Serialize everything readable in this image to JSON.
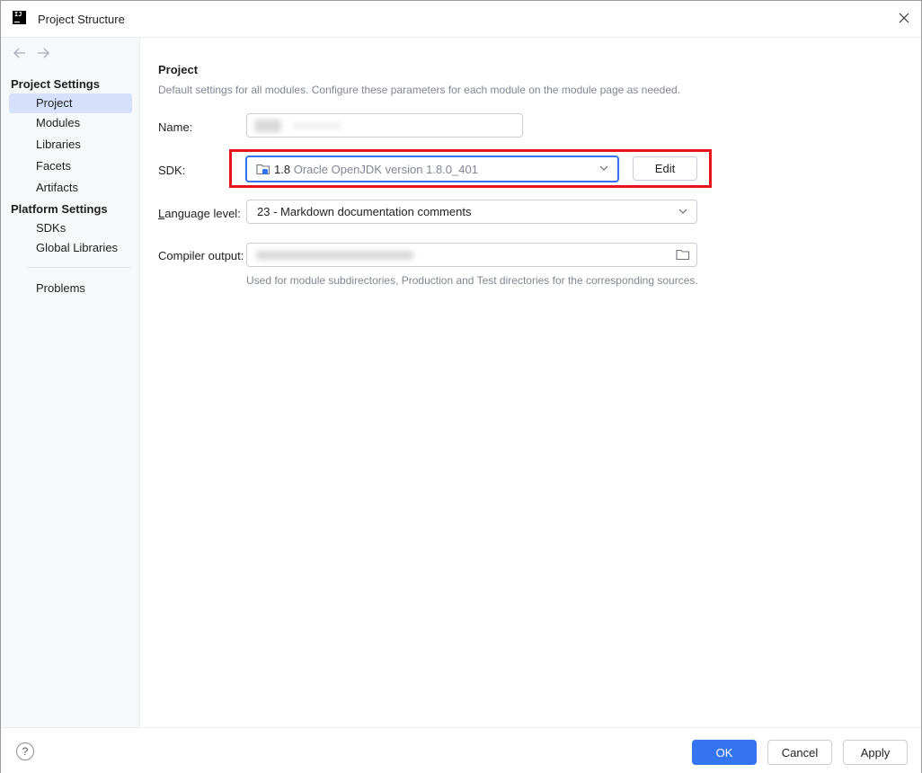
{
  "window": {
    "title": "Project Structure",
    "app_icon_text": "IJ"
  },
  "sidebar": {
    "groups": [
      {
        "header": "Project Settings",
        "items": [
          {
            "label": "Project",
            "selected": true
          },
          {
            "label": "Modules"
          },
          {
            "label": "Libraries"
          },
          {
            "label": "Facets"
          },
          {
            "label": "Artifacts"
          }
        ]
      },
      {
        "header": "Platform Settings",
        "items": [
          {
            "label": "SDKs"
          },
          {
            "label": "Global Libraries"
          }
        ]
      }
    ],
    "extra_items": [
      {
        "label": "Problems"
      }
    ]
  },
  "main": {
    "section_title": "Project",
    "section_desc": "Default settings for all modules. Configure these parameters for each module on the module page as needed.",
    "name_label": "Name:",
    "sdk": {
      "label": "SDK:",
      "version": "1.8",
      "description": "Oracle OpenJDK version 1.8.0_401",
      "edit_label": "Edit"
    },
    "language_level": {
      "label_prefix": "L",
      "label_rest": "anguage level:",
      "value": "23 - Markdown documentation comments"
    },
    "compiler_output": {
      "label": "Compiler output:",
      "hint": "Used for module subdirectories, Production and Test directories for the corresponding sources."
    }
  },
  "footer": {
    "help": "?",
    "ok": "OK",
    "cancel": "Cancel",
    "apply": "Apply"
  },
  "colors": {
    "accent": "#3574f0",
    "highlight": "#e8141b",
    "selection": "#d5e1fb"
  }
}
